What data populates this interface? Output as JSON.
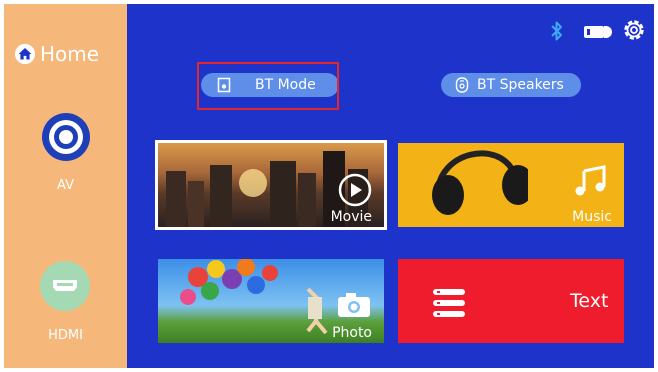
{
  "sidebar": {
    "home_label": "Home",
    "items": [
      {
        "label": "AV",
        "icon": "av-input-icon"
      },
      {
        "label": "HDMI",
        "icon": "hdmi-icon"
      }
    ]
  },
  "status_icons": [
    "bluetooth-icon",
    "battery-icon",
    "settings-gear-icon"
  ],
  "mode_buttons": [
    {
      "label": "BT Mode",
      "icon": "speaker-icon",
      "selected": true
    },
    {
      "label": "BT Speakers",
      "icon": "speaker-outline-icon",
      "selected": false
    }
  ],
  "tiles": [
    {
      "label": "Movie",
      "icon": "play-icon",
      "focused": true
    },
    {
      "label": "Music",
      "icon": "music-note-icon"
    },
    {
      "label": "Photo",
      "icon": "camera-icon"
    },
    {
      "label": "Text",
      "icon": "list-icon"
    }
  ],
  "colors": {
    "background": "#1d33c9",
    "sidebar": "#f5b77a",
    "pill": "#5e8ee8",
    "selection_border": "#e3262b",
    "music_tile": "#f3b316",
    "text_tile": "#ee1c2c",
    "bluetooth": "#3fa9f5"
  }
}
